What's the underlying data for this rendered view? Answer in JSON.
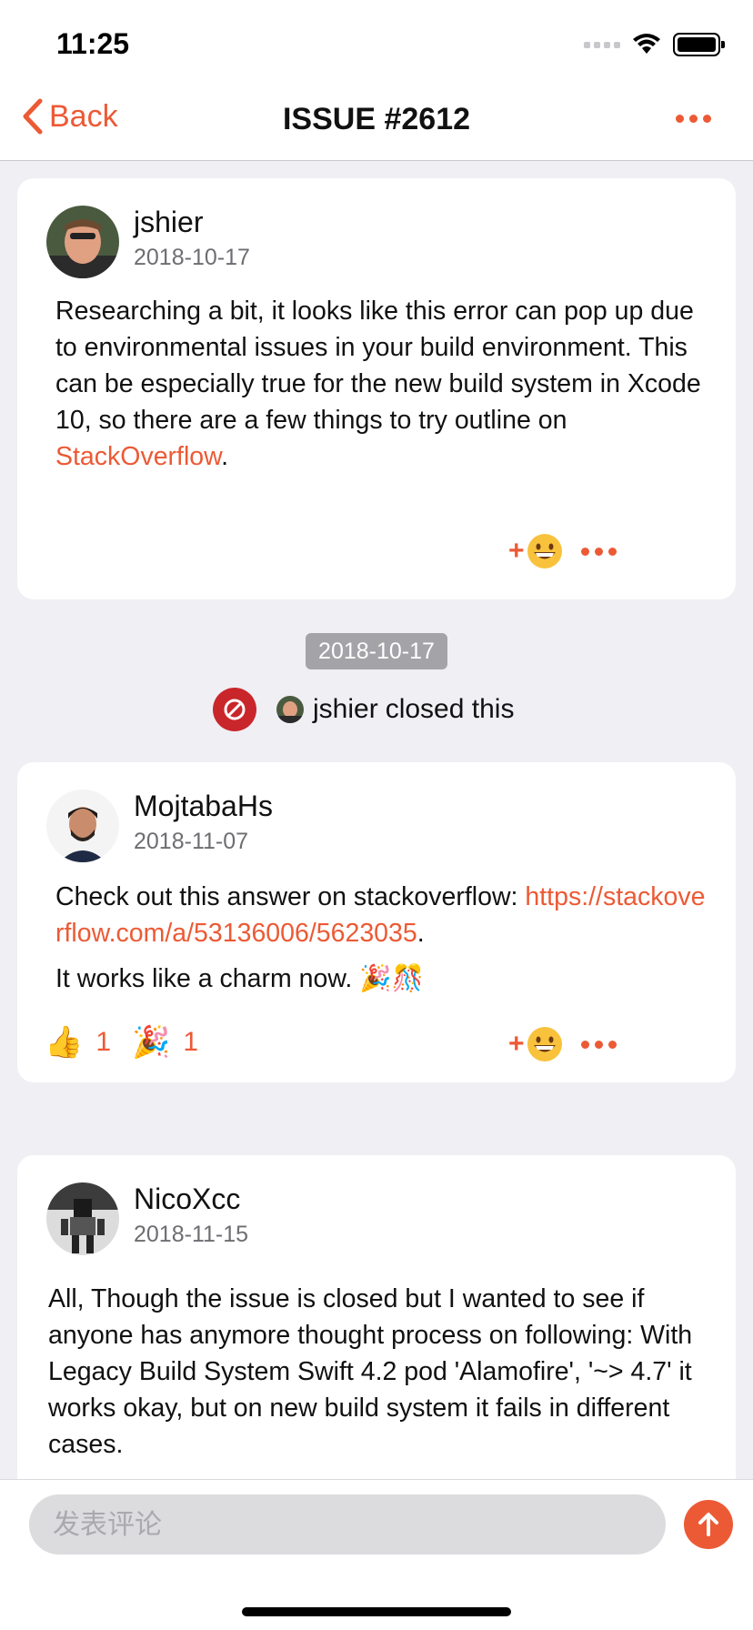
{
  "status_bar": {
    "time": "11:25"
  },
  "nav": {
    "back_label": "Back",
    "title": "ISSUE #2612"
  },
  "comments": [
    {
      "author": "jshier",
      "date": "2018-10-17",
      "text_before_link": "Researching a bit, it looks like this error can pop up due to environmental issues in your build environment. This can be especially true for the new build system in Xcode 10, so there are a few things to try outline on ",
      "link": "StackOverflow",
      "text_after_link": "."
    },
    {
      "author": "MojtabaHs",
      "date": "2018-11-07",
      "text_before_link": "Check out this answer on stackoverflow: ",
      "link": "https://stackoverflow.com/a/53136006/5623035",
      "text_after_link": ".",
      "second_paragraph": "It works like a charm now. 🎉🎊",
      "reactions": [
        {
          "emoji": "👍",
          "count": "1"
        },
        {
          "emoji": "🎉",
          "count": "1"
        }
      ]
    },
    {
      "author": "NicoXcc",
      "date": "2018-11-15",
      "text": "All, Though the issue is closed but I wanted to see if anyone has anymore thought process on following: With Legacy Build System Swift 4.2 pod 'Alamofire', '~> 4.7' it works okay, but on new build system it fails in different cases."
    }
  ],
  "event": {
    "date": "2018-10-17",
    "actor": "jshier",
    "action": "closed this"
  },
  "composer": {
    "placeholder": "发表评论"
  },
  "colors": {
    "accent": "#ec5a35",
    "closed": "#c9262c"
  }
}
